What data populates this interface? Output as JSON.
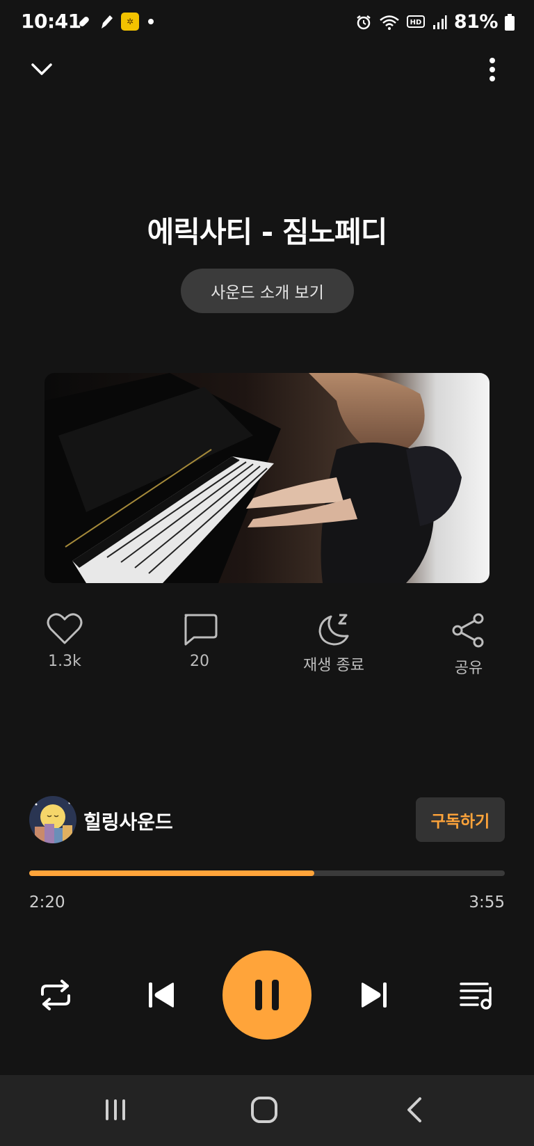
{
  "status_bar": {
    "time": "10:41",
    "battery": "81%",
    "left_icons": [
      "bandage-icon",
      "pen-icon",
      "kt-app-icon",
      "dot-icon"
    ],
    "right_icons": [
      "alarm-icon",
      "wifi-icon",
      "hd-icon",
      "signal-icon",
      "battery-icon"
    ]
  },
  "header": {
    "collapse_icon": "chevron-down-icon",
    "menu_icon": "more-vertical-icon"
  },
  "track": {
    "title": "에릭사티 - 짐노페디",
    "intro_button": "사운드 소개 보기",
    "artwork_description_icon": "piano-artwork"
  },
  "actions": [
    {
      "icon": "heart-icon",
      "label": "1.3k"
    },
    {
      "icon": "comment-icon",
      "label": "20"
    },
    {
      "icon": "sleep-timer-icon",
      "label": "재생 종료"
    },
    {
      "icon": "share-icon",
      "label": "공유"
    }
  ],
  "channel": {
    "name": "힐링사운드",
    "subscribe": "구독하기"
  },
  "progress": {
    "current": "2:20",
    "total": "3:55",
    "fraction": 0.6
  },
  "controls": [
    "repeat-icon",
    "previous-icon",
    "pause-icon",
    "next-icon",
    "playlist-icon"
  ],
  "colors": {
    "background": "#141414",
    "accent": "#ffa43a",
    "pill": "#3b3b3b",
    "nav": "#232323"
  }
}
